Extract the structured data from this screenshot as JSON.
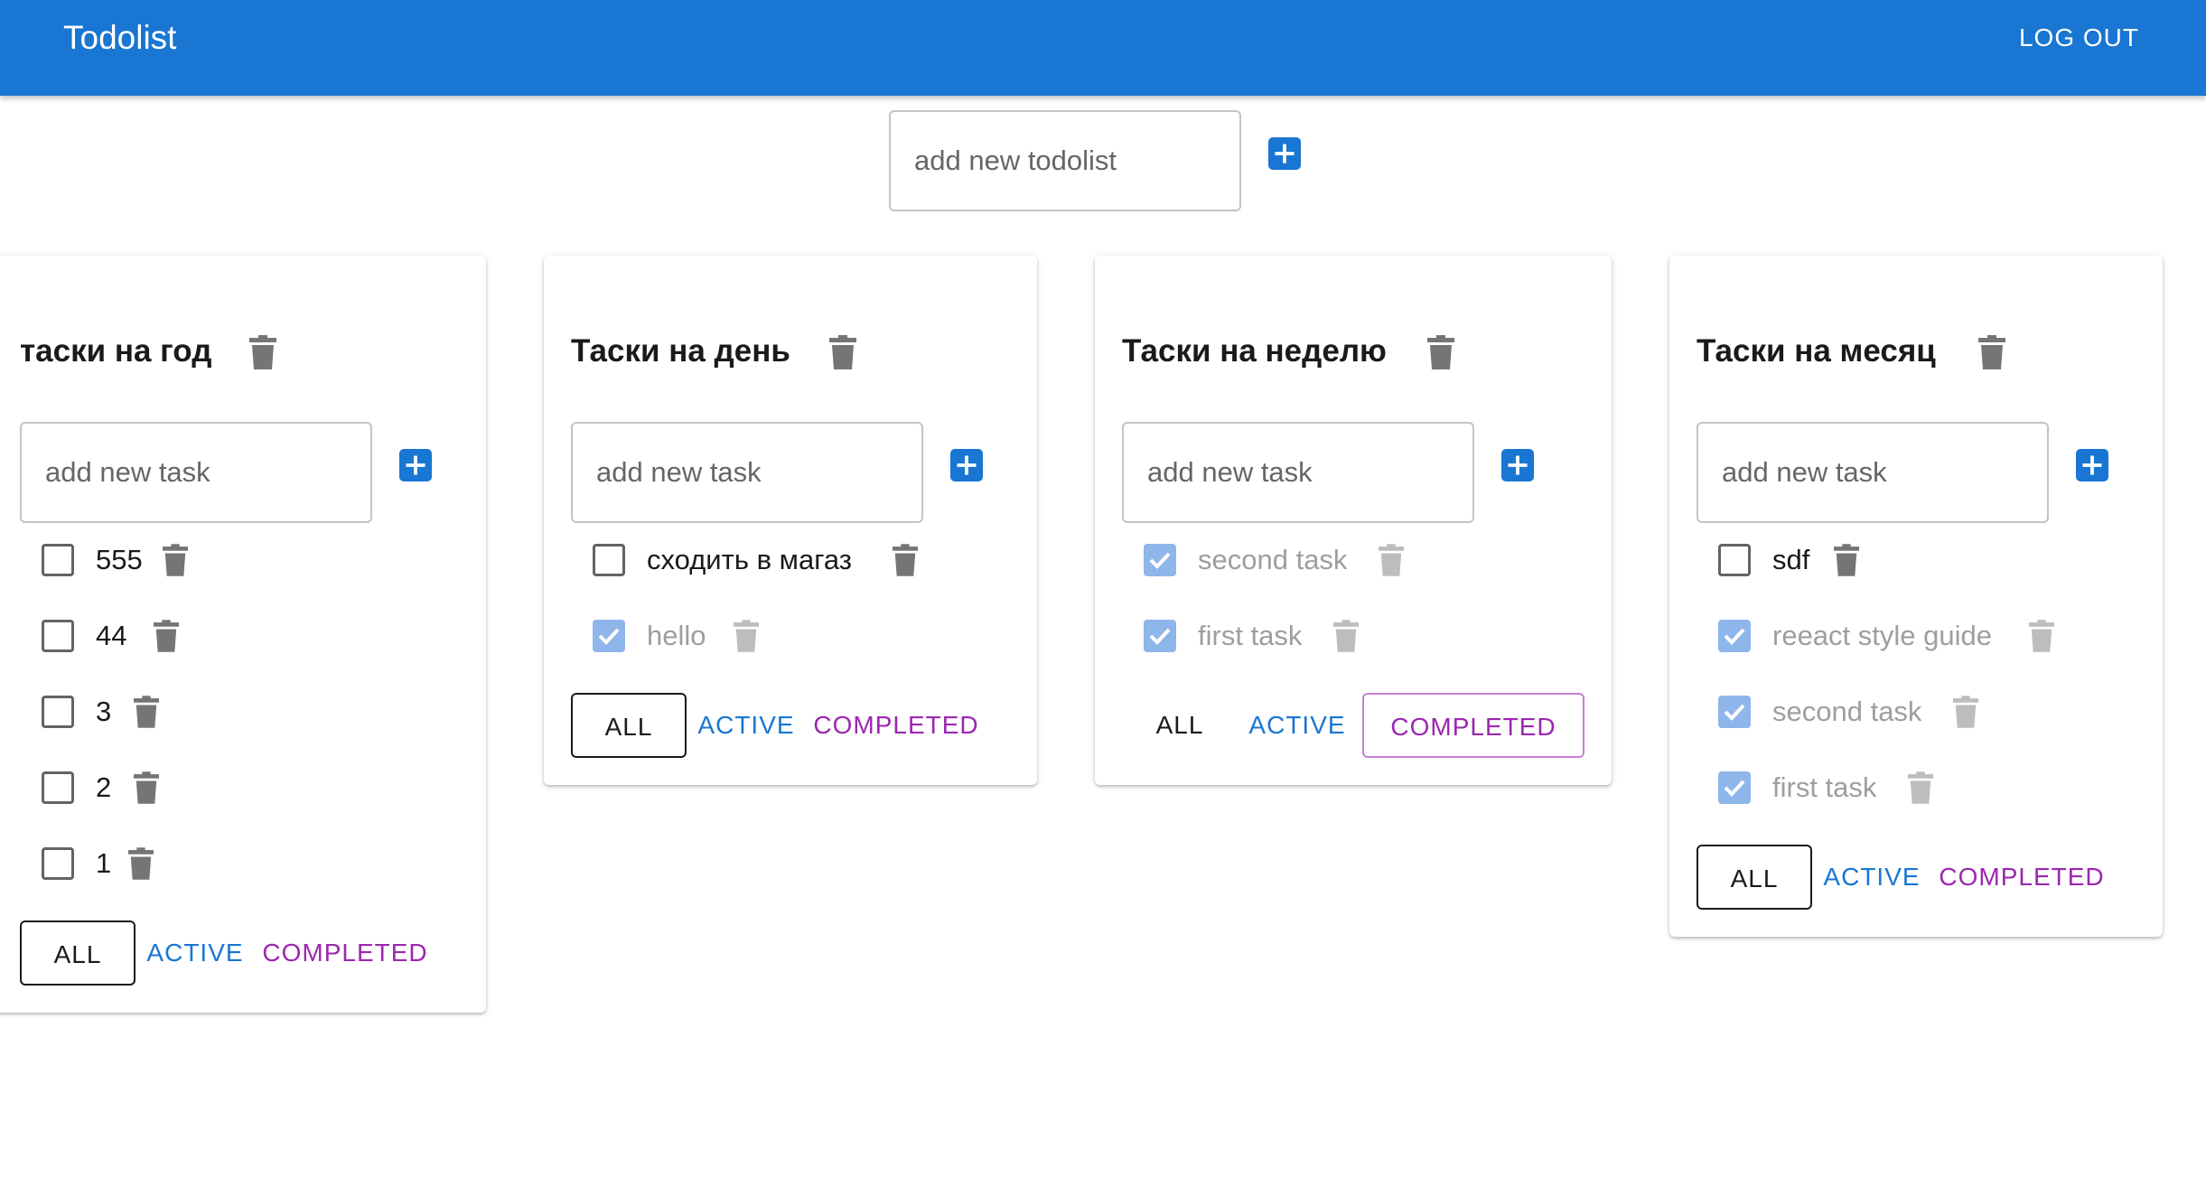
{
  "header": {
    "title": "Todolist",
    "logout_label": "LOG OUT"
  },
  "new_todolist": {
    "placeholder": "add new todolist"
  },
  "colors": {
    "primary": "#1976d2",
    "secondary": "#9c27b0",
    "checkbox_checked": "#8fb6ea",
    "icon_gray": "#757575"
  },
  "todolists": [
    {
      "title": "таски на год",
      "input_placeholder": "add new task",
      "tasks": [
        {
          "title": "555",
          "done": false
        },
        {
          "title": "44",
          "done": false
        },
        {
          "title": "3",
          "done": false
        },
        {
          "title": "2",
          "done": false
        },
        {
          "title": "1",
          "done": false
        }
      ],
      "filters": {
        "all": "ALL",
        "active": "ACTIVE",
        "completed": "COMPLETED",
        "selected": "all"
      }
    },
    {
      "title": "Таски на день",
      "input_placeholder": "add new task",
      "tasks": [
        {
          "title": "сходить в магаз",
          "done": false
        },
        {
          "title": "hello",
          "done": true
        }
      ],
      "filters": {
        "all": "ALL",
        "active": "ACTIVE",
        "completed": "COMPLETED",
        "selected": "all"
      }
    },
    {
      "title": "Таски на неделю",
      "input_placeholder": "add new task",
      "tasks": [
        {
          "title": "second task",
          "done": true
        },
        {
          "title": "first task",
          "done": true
        }
      ],
      "filters": {
        "all": "ALL",
        "active": "ACTIVE",
        "completed": "COMPLETED",
        "selected": "completed"
      }
    },
    {
      "title": "Таски на месяц",
      "input_placeholder": "add new task",
      "tasks": [
        {
          "title": "sdf",
          "done": false
        },
        {
          "title": "reeact style guide",
          "done": true
        },
        {
          "title": "second task",
          "done": true
        },
        {
          "title": "first task",
          "done": true
        }
      ],
      "filters": {
        "all": "ALL",
        "active": "ACTIVE",
        "completed": "COMPLETED",
        "selected": "all"
      }
    }
  ]
}
